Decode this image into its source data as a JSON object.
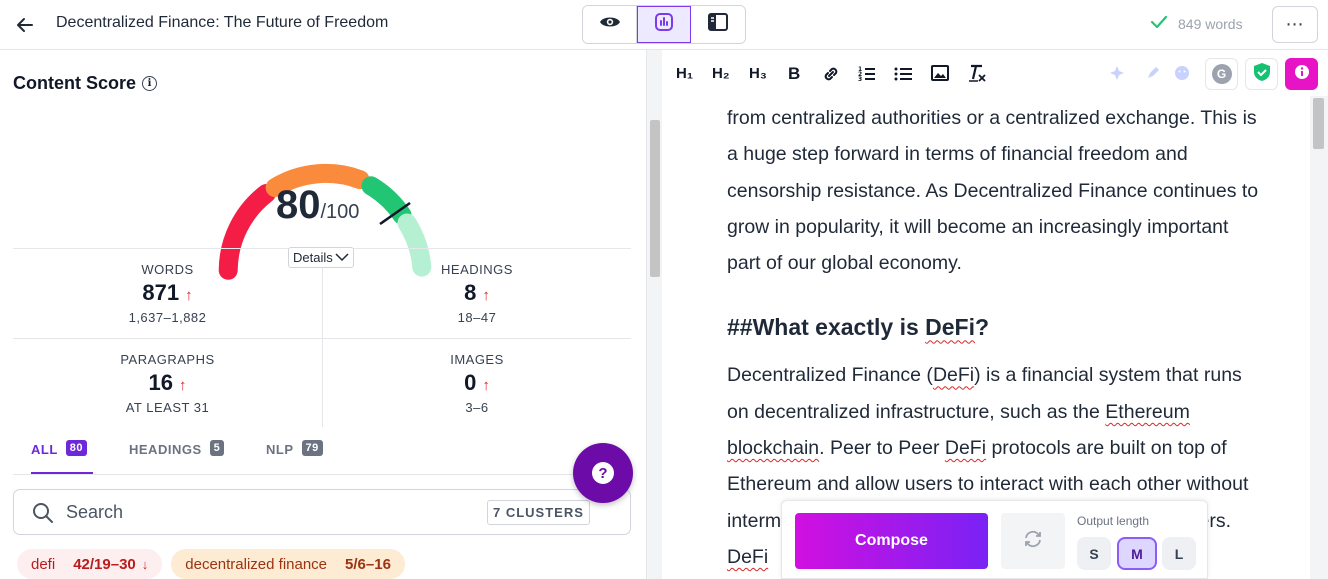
{
  "header": {
    "title": "Decentralized Finance: The Future of Freedom",
    "word_count": "849 words",
    "more_label": "⋯",
    "view_modes": [
      "eye-icon",
      "score-icon",
      "panel-icon"
    ],
    "active_view": "score-icon"
  },
  "score": {
    "title": "Content Score",
    "value": "80",
    "max": "/100",
    "fraction": 0.8,
    "details_label": "Details",
    "colors": {
      "red": "#f41d45",
      "orange": "#fa8a3c",
      "green": "#22c573",
      "light_green": "#b6f0d3"
    }
  },
  "stats": [
    {
      "label": "WORDS",
      "value": "871",
      "arrow": "↑",
      "range": "1,637–1,882"
    },
    {
      "label": "HEADINGS",
      "value": "8",
      "arrow": "↑",
      "range": "18–47"
    },
    {
      "label": "PARAGRAPHS",
      "value": "16",
      "arrow": "↑",
      "range": "AT LEAST 31"
    },
    {
      "label": "IMAGES",
      "value": "0",
      "arrow": "↑",
      "range": "3–6"
    }
  ],
  "tabs": [
    {
      "label": "ALL",
      "count": "80"
    },
    {
      "label": "HEADINGS",
      "count": "5"
    },
    {
      "label": "NLP",
      "count": "79"
    }
  ],
  "search": {
    "placeholder": "Search",
    "cluster_label": "7 CLUSTERS"
  },
  "help_label": "?",
  "keywords": [
    {
      "term": "defi",
      "count": "42/19–30",
      "trend": "↓"
    },
    {
      "term": "decentralized finance",
      "count": "5/6–16",
      "trend": ""
    }
  ],
  "toolbar": {
    "h1": "H₁",
    "h2": "H₂",
    "h3": "H₃",
    "bold": "B"
  },
  "editor": {
    "para1": "from centralized authorities or a centralized exchange. This is a huge step forward in terms of financial freedom and censorship resistance. As Decentralized Finance continues to grow in popularity, it will become an increasingly important part of our global economy.",
    "heading_prefix": "##What exactly is ",
    "heading_word": "DeFi",
    "heading_suffix": "?",
    "para2_a": "Decentralized Finance (",
    "para2_defi": "DeFi",
    "para2_b": ")  is a financial system that runs on decentralized infrastructure, such as the ",
    "para2_eth": "Ethereum",
    "para2_space": " ",
    "para2_bc": "blockchain",
    "para2_c": ". Peer to Peer ",
    "para2_defi2": "DeFi",
    "para2_d": " protocols are built on top of Ethereum and allow users to interact with each other without intermediaries, cutting out the need for banks and brokers. ",
    "para2_defi3": "DeFi"
  },
  "compose": {
    "button_label": "Compose",
    "output_label": "Output length",
    "sizes": [
      "S",
      "M",
      "L"
    ],
    "selected_size": "M",
    "gradient": [
      "#d10fe0",
      "#7a22f5"
    ]
  }
}
